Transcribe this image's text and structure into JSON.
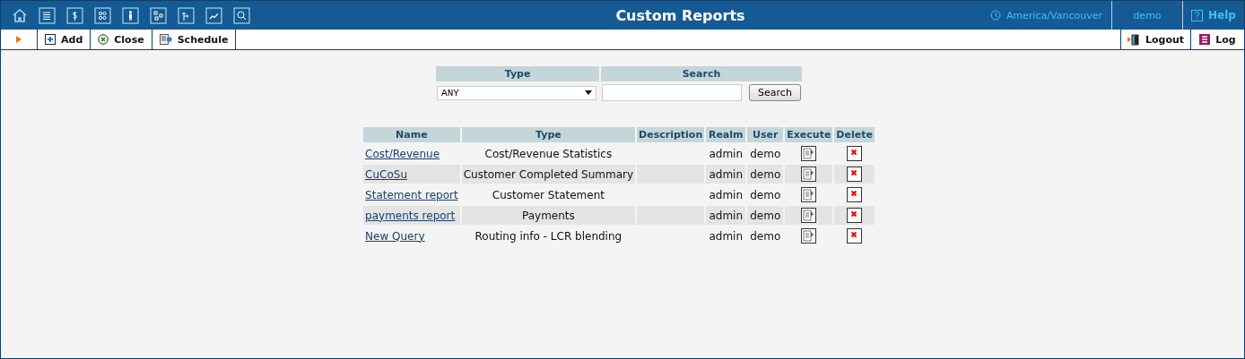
{
  "header": {
    "title": "Custom Reports",
    "timezone": "America/Vancouver",
    "user": "demo",
    "help": "Help"
  },
  "toolbar": {
    "left": [
      {
        "kind": "add",
        "label": "Add"
      },
      {
        "kind": "close",
        "label": "Close"
      },
      {
        "kind": "schedule",
        "label": "Schedule"
      }
    ],
    "right": [
      {
        "kind": "logout",
        "label": "Logout"
      },
      {
        "kind": "log",
        "label": "Log"
      }
    ]
  },
  "filter": {
    "type_label": "Type",
    "search_label": "Search",
    "type_value": "ANY",
    "search_button": "Search"
  },
  "table": {
    "columns": [
      "Name",
      "Type",
      "Description",
      "Realm",
      "User",
      "Execute",
      "Delete"
    ],
    "rows": [
      {
        "name": "Cost/Revenue",
        "type": "Cost/Revenue Statistics",
        "realm": "admin",
        "user": "demo"
      },
      {
        "name": "CuCoSu",
        "type": "Customer Completed Summary",
        "realm": "admin",
        "user": "demo"
      },
      {
        "name": "Statement report",
        "type": "Customer Statement",
        "realm": "admin",
        "user": "demo"
      },
      {
        "name": "payments report",
        "type": "Payments",
        "realm": "admin",
        "user": "demo"
      },
      {
        "name": "New Query",
        "type": "Routing info - LCR blending",
        "realm": "admin",
        "user": "demo"
      }
    ]
  }
}
